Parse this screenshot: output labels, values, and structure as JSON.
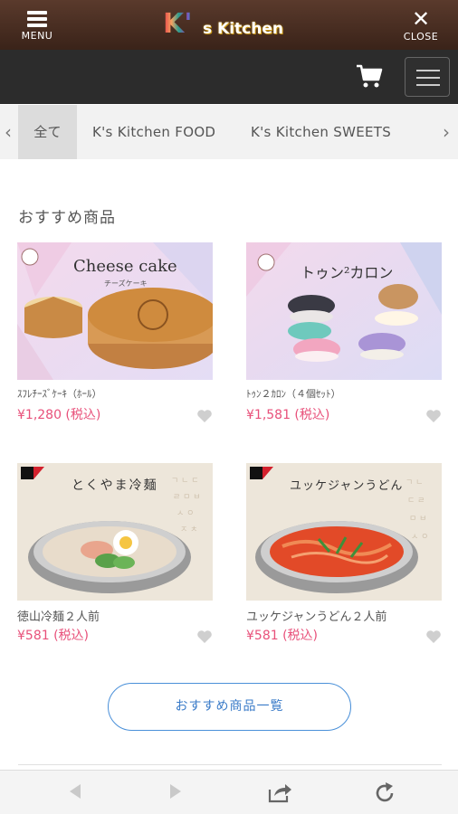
{
  "header": {
    "menu_label": "MENU",
    "close_label": "CLOSE",
    "logo_k": "K'",
    "logo_rest": "s Kitchen"
  },
  "categories": {
    "tabs": [
      {
        "label": "全て",
        "active": true
      },
      {
        "label": "K's Kitchen FOOD",
        "active": false
      },
      {
        "label": "K's Kitchen SWEETS",
        "active": false
      }
    ]
  },
  "section": {
    "title": "おすすめ商品"
  },
  "products": [
    {
      "name": "ｽﾌﾚﾁｰｽﾞｹｰｷ（ﾎｰﾙ）",
      "price": "¥1,280 (税込)",
      "image_text": "Cheese cake",
      "image_subtext": "チーズケーキ"
    },
    {
      "name": "ﾄｩﾝ２ｶﾛﾝ（４個ｾｯﾄ）",
      "price": "¥1,581 (税込)",
      "image_text": "トゥン²カロン"
    },
    {
      "name": "徳山冷麺２人前",
      "price": "¥581 (税込)",
      "image_text": "とくやま冷麺"
    },
    {
      "name": "ユッケジャンうどん２人前",
      "price": "¥581 (税込)",
      "image_text": "ユッケジャンうどん"
    }
  ],
  "more_button": {
    "label": "おすすめ商品一覧"
  },
  "colors": {
    "price": "#e8507a",
    "accent_blue": "#3a7bc8",
    "header_brown": "#3a2319"
  }
}
